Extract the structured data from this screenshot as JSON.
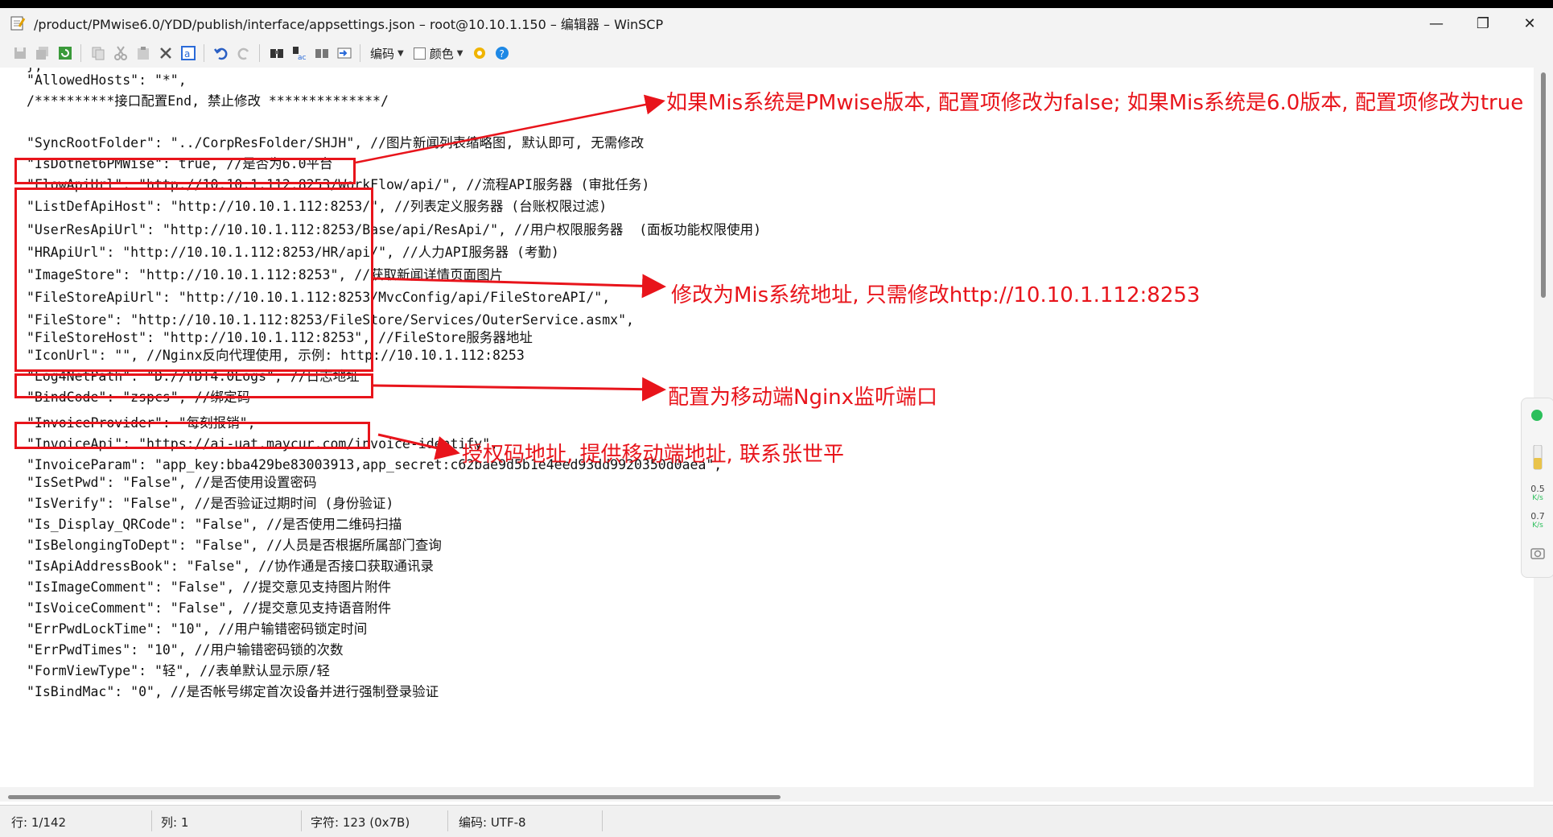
{
  "window": {
    "title": "/product/PMwise6.0/YDD/publish/interface/appsettings.json – root@10.10.1.150 – 编辑器 – WinSCP",
    "minimize_icon": "minimize-icon",
    "maximize_icon": "restore-icon",
    "close_icon": "close-icon"
  },
  "toolbar": {
    "encoding_label": "编码",
    "color_label": "颜色"
  },
  "code_lines": [
    "},",
    "\"AllowedHosts\": \"*\",",
    "/**********接口配置End, 禁止修改 **************/",
    "",
    "\"SyncRootFolder\": \"../CorpResFolder/SHJH\", //图片新闻列表缩略图, 默认即可, 无需修改",
    "\"IsDotnet6PMWise\": true, //是否为6.0平台",
    "\"FlowApiUrl\": \"http://10.10.1.112:8253/WorkFlow/api/\", //流程API服务器 (审批任务)",
    "\"ListDefApiHost\": \"http://10.10.1.112:8253/\", //列表定义服务器 (台账权限过滤)",
    "\"UserResApiUrl\": \"http://10.10.1.112:8253/Base/api/ResApi/\", //用户权限服务器  (面板功能权限使用)",
    "\"HRApiUrl\": \"http://10.10.1.112:8253/HR/api/\", //人力API服务器 (考勤)",
    "\"ImageStore\": \"http://10.10.1.112:8253\", //获取新闻详情页面图片",
    "\"FileStoreApiUrl\": \"http://10.10.1.112:8253/MvcConfig/api/FileStoreAPI/\",",
    "\"FileStore\": \"http://10.10.1.112:8253/FileStore/Services/OuterService.asmx\",",
    "\"FileStoreHost\": \"http://10.10.1.112:8253\", //FileStore服务器地址",
    "\"IconUrl\": \"\", //Nginx反向代理使用, 示例: http://10.10.1.112:8253",
    "\"Log4NetPath\": \"D://YDT4.0Logs\", //日志地址",
    "\"BindCode\": \"zspcs\", //绑定码",
    "\"InvoiceProvider\": \"每刻报销\",",
    "\"InvoiceApi\": \"https://ai-uat.maycur.com/invoice-identify\",",
    "\"InvoiceParam\": \"app_key:bba429be83003913,app_secret:c62bae9d5b1e4eed93dd9920350d0aea\",",
    "\"IsSetPwd\": \"False\", //是否使用设置密码",
    "\"IsVerify\": \"False\", //是否验证过期时间 (身份验证)",
    "\"Is_Display_QRCode\": \"False\", //是否使用二维码扫描",
    "\"IsBelongingToDept\": \"False\", //人员是否根据所属部门查询",
    "\"IsApiAddressBook\": \"False\", //协作通是否接口获取通讯录",
    "\"IsImageComment\": \"False\", //提交意见支持图片附件",
    "\"IsVoiceComment\": \"False\", //提交意见支持语音附件",
    "\"ErrPwdLockTime\": \"10\", //用户输错密码锁定时间",
    "\"ErrPwdTimes\": \"10\", //用户输错密码锁的次数",
    "\"FormViewType\": \"轻\", //表单默认显示原/轻",
    "\"IsBindMac\": \"0\", //是否帐号绑定首次设备并进行强制登录验证"
  ],
  "annotations": {
    "a1": "如果Mis系统是PMwise版本, 配置项修改为false; 如果Mis系统是6.0版本, 配置项修改为true",
    "a2": "修改为Mis系统地址, 只需修改http://10.10.1.112:8253",
    "a3": "配置为移动端Nginx监听端口",
    "a4": "授权码地址, 提供移动端地址, 联系张世平"
  },
  "side_widget": {
    "up_value": "0.5",
    "up_unit": "K/s",
    "down_value": "0.7",
    "down_unit": "K/s"
  },
  "status": {
    "line": "行: 1/142",
    "col": "列: 1",
    "char": "字符: 123 (0x7B)",
    "encoding": "编码: UTF-8"
  },
  "colors": {
    "annotation_red": "#e8141b",
    "chrome": "#f3f3f3"
  }
}
